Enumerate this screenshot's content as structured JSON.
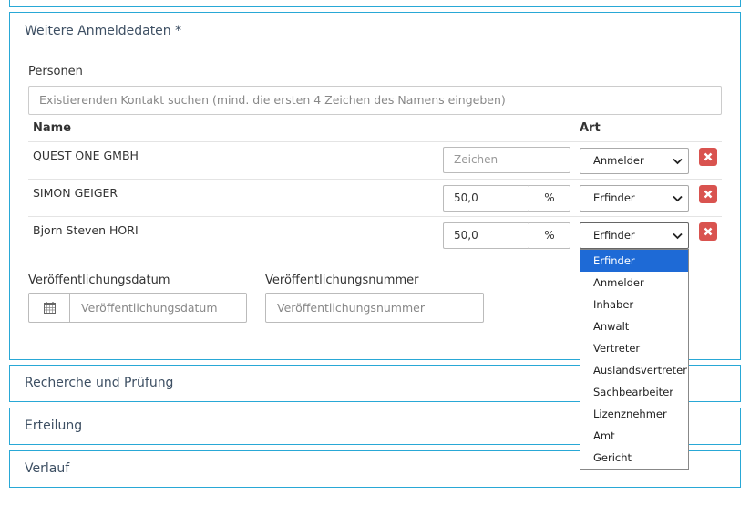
{
  "panels": {
    "main_title": "Weitere Anmeldedaten *",
    "collapsed": [
      {
        "title": "Recherche und Prüfung"
      },
      {
        "title": "Erteilung"
      },
      {
        "title": "Verlauf"
      }
    ]
  },
  "persons": {
    "label": "Personen",
    "search_placeholder": "Existierenden Kontakt suchen (mind. die ersten 4 Zeichen des Namens eingeben)",
    "col_name": "Name",
    "col_art": "Art",
    "rows": [
      {
        "name": "QUEST ONE GMBH",
        "input_placeholder": "Zeichen",
        "art": "Anmelder"
      },
      {
        "name": "SIMON GEIGER",
        "share": "50,0",
        "unit": "%",
        "art": "Erfinder"
      },
      {
        "name": "Bjorn Steven HORI",
        "share": "50,0",
        "unit": "%",
        "art": "Erfinder"
      }
    ]
  },
  "publication": {
    "date_label": "Veröffentlichungsdatum",
    "date_placeholder": "Veröffentlichungsdatum",
    "number_label": "Veröffentlichungsnummer",
    "number_placeholder": "Veröffentlichungsnummer",
    "date_icon": "calendar-icon"
  },
  "dropdown": {
    "selected": "Erfinder",
    "options": [
      "Erfinder",
      "Anmelder",
      "Inhaber",
      "Anwalt",
      "Vertreter",
      "Auslandsvertreter",
      "Sachbearbeiter",
      "Lizenznehmer",
      "Amt",
      "Gericht"
    ]
  },
  "colors": {
    "panel_border": "#29a8d6",
    "delete_button": "#d9534f",
    "dropdown_highlight": "#1e6ad6"
  }
}
